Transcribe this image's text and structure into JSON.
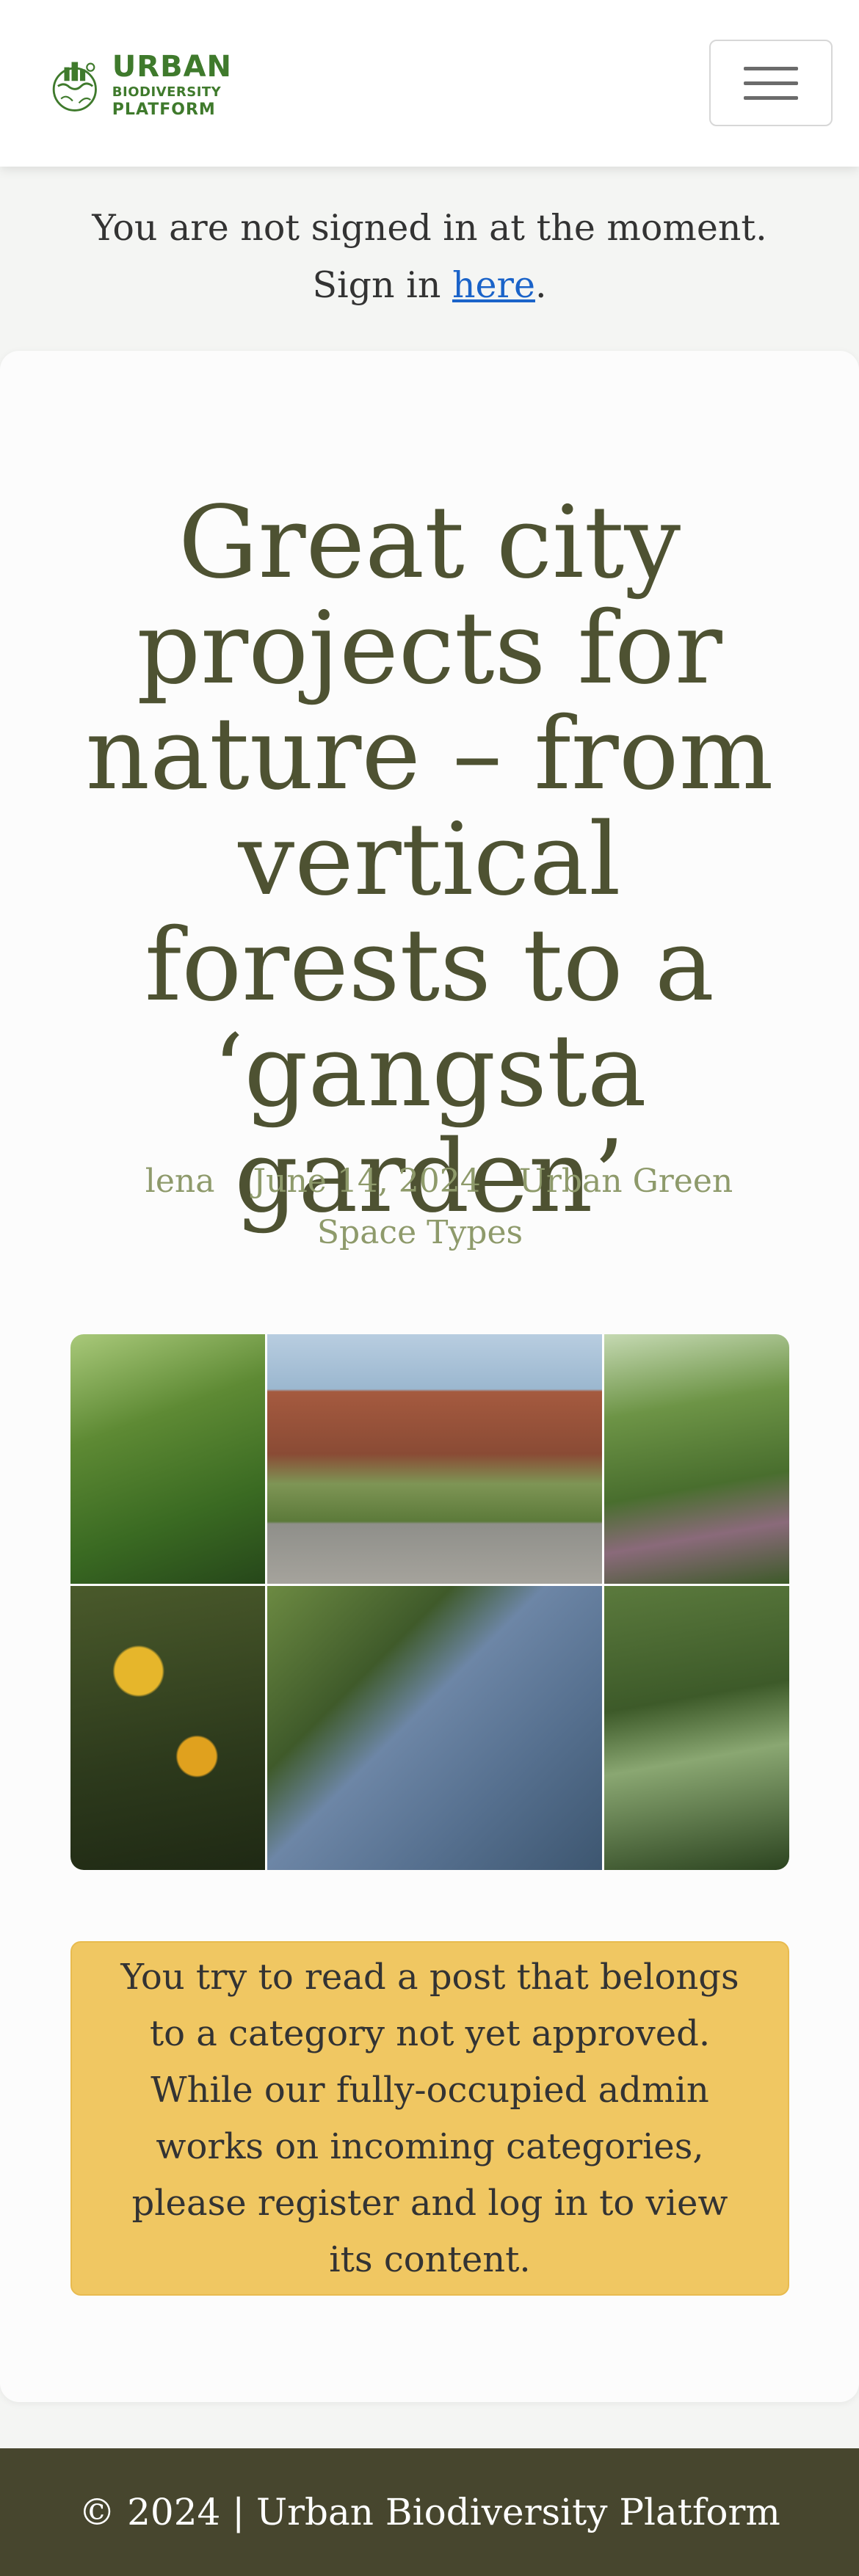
{
  "header": {
    "logo": {
      "line1": "URBAN",
      "line2": "BIODIVERSITY",
      "line3": "PLATFORM"
    },
    "menu_icon": "hamburger-icon"
  },
  "signin_notice": {
    "text_line1": "You are not signed in at the moment.",
    "text_line2_prefix": "Sign in ",
    "link_text": "here",
    "text_line2_suffix": "."
  },
  "post": {
    "title": "Great city projects for nature – from vertical forests to a ‘gangsta garden’",
    "author": "lena",
    "date": "June 14, 2024",
    "category": "Urban Green Space Types",
    "warning": "You try to read a post that belongs to a category not yet approved. While our fully-occupied admin works on incoming categories, please register and log in to view its content."
  },
  "collage": {
    "tiles": [
      "tall-green-plants",
      "brick-building-planters",
      "pink-flowers",
      "yellow-flowers",
      "man-with-glasses-in-garden",
      "white-flowering-plants"
    ]
  },
  "footer": {
    "text": "© 2024 | Urban Biodiversity Platform"
  },
  "colors": {
    "logo_green": "#3f7a2c",
    "title_olive": "#4e5232",
    "meta_olive": "#8e9a6b",
    "link_blue": "#1a63c9",
    "warning_bg": "#f0c762",
    "footer_bg": "#47462e"
  }
}
